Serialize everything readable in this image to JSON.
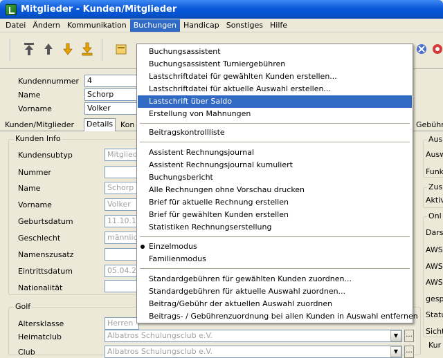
{
  "window": {
    "title": "Mitglieder - Kunden/Mitglieder"
  },
  "menubar": [
    {
      "label": "Datei"
    },
    {
      "label": "Ändern"
    },
    {
      "label": "Kommunikation"
    },
    {
      "label": "Buchungen"
    },
    {
      "label": "Handicap"
    },
    {
      "label": "Sonstiges"
    },
    {
      "label": "Hilfe"
    }
  ],
  "toolbar": {
    "icons": [
      "first-record-icon",
      "prev-record-icon",
      "next-record-icon",
      "last-record-icon",
      "folder-icon",
      "blue-tool-icon",
      "red-tool-icon"
    ],
    "colors": {
      "nav": "#555555",
      "nav_alt": "#e8a400"
    }
  },
  "header_fields": [
    {
      "label": "Kundennummer",
      "value": "4"
    },
    {
      "label": "Name",
      "value": "Schorp"
    },
    {
      "label": "Vorname",
      "value": "Volker"
    }
  ],
  "tabs": [
    {
      "label": "Kunden/Mitglieder"
    },
    {
      "label": "Details"
    },
    {
      "label": "Kon"
    },
    {
      "label": "Gebühre"
    }
  ],
  "kunden_info": {
    "title": "Kunden Info",
    "rows": [
      {
        "label": "Kundensubtyp",
        "value": "Mitglied"
      },
      {
        "label": "Nummer",
        "value": ""
      },
      {
        "label": "Name",
        "value": "Schorp"
      },
      {
        "label": "Vorname",
        "value": "Volker"
      },
      {
        "label": "Geburtsdatum",
        "value": "11.10.1"
      },
      {
        "label": "Geschlecht",
        "value": "männlich"
      },
      {
        "label": "Namenszusatz",
        "value": ""
      },
      {
        "label": "Eintrittsdatum",
        "value": "05.04.2"
      },
      {
        "label": "Nationalität",
        "value": ""
      }
    ]
  },
  "golf": {
    "title": "Golf",
    "rows": [
      {
        "label": "Altersklasse",
        "value": "Herren"
      },
      {
        "label": "Heimatclub",
        "value": "Albatros Schulungsclub e.V."
      },
      {
        "label": "Club",
        "value": "Albatros Schulungsclub e.V."
      }
    ]
  },
  "right_panel": {
    "group_titles": [
      "Aus",
      "Zus",
      "Onl",
      "Kur"
    ],
    "labels": [
      "Ausw",
      "Funk",
      "Aktiv",
      "Dars",
      "AWS",
      "AWS",
      "AWS",
      "gesp",
      "Statu",
      "Sicht"
    ]
  },
  "buchungen_menu": {
    "items": [
      "Buchungsassistent",
      "Buchungsassistent Turniergebühren",
      "Lastschriftdatei für gewählten Kunden erstellen...",
      "Lastschriftdatei für aktuelle Auswahl erstellen...",
      "Lastschrift über Saldo",
      "Erstellung von Mahnungen",
      "Beitragskontrollliste",
      "Assistent Rechnungsjournal",
      "Assistent Rechnungsjournal kumuliert",
      "Buchungsbericht",
      "Alle Rechnungen ohne Vorschau drucken",
      "Brief für aktuelle Rechnung erstellen",
      "Brief für gewählten Kunden erstellen",
      "Statistiken Rechnungserstellung",
      "Einzelmodus",
      "Familienmodus",
      "Standardgebühren für gewählten Kunden zuordnen...",
      "Standardgebühren für aktuelle Auswahl zuordnen...",
      "Beitrag/Gebühr der aktuellen Auswahl zuordnen",
      "Beitrags- / Gebührenzuordnung bei allen Kunden in Auswahl entfernen"
    ],
    "highlighted": "Lastschrift über Saldo",
    "checked": "Einzelmodus",
    "highlight_color": "#316ac5"
  }
}
